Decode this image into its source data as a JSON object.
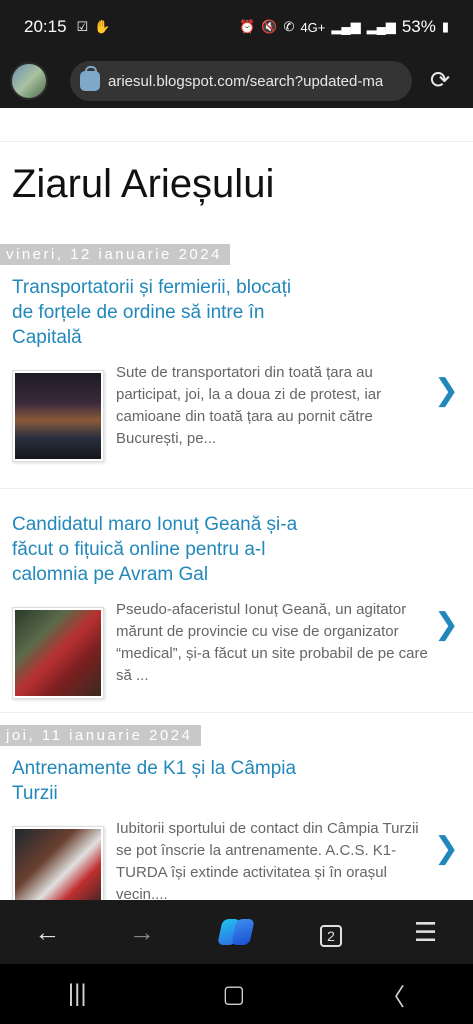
{
  "status": {
    "time": "20:15",
    "left_icons": [
      "checkbox-icon",
      "hand-icon"
    ],
    "network": "4G+",
    "battery": "53%"
  },
  "browser": {
    "url": "ariesul.blogspot.com/search?updated-ma",
    "tab_count": "2"
  },
  "blog": {
    "title": "Ziarul Arieșului",
    "dates": [
      "vineri, 12 ianuarie 2024",
      "joi, 11 ianuarie 2024"
    ],
    "posts": [
      {
        "title": "Transportatorii și fermierii, blocați de forțele de ordine să intre în Capitală",
        "snippet": "Sute de transportatori din toată țara au participat, joi, la a doua zi de protest, iar camioane din toată țara au pornit către București, pe..."
      },
      {
        "title": "Candidatul maro Ionuț Geană și-a făcut o fițuică online pentru a-l calomnia pe Avram Gal",
        "snippet": "Pseudo-afaceristul Ionuț Geană, un agitator mărunt de provincie cu vise de organizator “medical”, și-a făcut un site probabil de pe care să ..."
      },
      {
        "title": "Antrenamente de K1 și la Câmpia Turzii",
        "snippet": "Iubitorii sportului de contact din Câmpia Turzii se pot înscrie la antrenamente. A.C.S. K1-TURDA își extinde activitatea și în orașul vecin...."
      }
    ],
    "chevron": "❯"
  },
  "colors": {
    "link": "#2288bb",
    "date_bg": "#c8c8c8",
    "chrome_bg": "#1a1a1a"
  }
}
